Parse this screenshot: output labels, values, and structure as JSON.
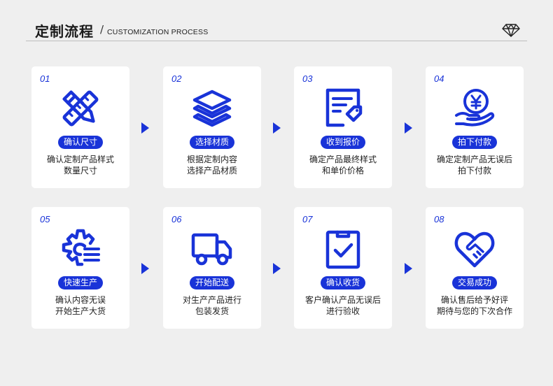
{
  "header": {
    "title": "定制流程",
    "separator": "/",
    "subtitle": "CUSTOMIZATION PROCESS"
  },
  "colors": {
    "accent": "#1933d8",
    "card": "#ffffff",
    "background": "#efefef"
  },
  "steps": [
    {
      "num": "01",
      "label": "确认尺寸",
      "line1": "确认定制产品样式",
      "line2": "数量尺寸",
      "icon": "pencil-ruler-icon"
    },
    {
      "num": "02",
      "label": "选择材质",
      "line1": "根据定制内容",
      "line2": "选择产品材质",
      "icon": "layers-icon"
    },
    {
      "num": "03",
      "label": "收到报价",
      "line1": "确定产品最终样式",
      "line2": "和单价价格",
      "icon": "price-sheet-icon"
    },
    {
      "num": "04",
      "label": "拍下付款",
      "line1": "确定定制产品无误后",
      "line2": "拍下付款",
      "icon": "yen-coin-hand-icon"
    },
    {
      "num": "05",
      "label": "快速生产",
      "line1": "确认内容无误",
      "line2": "开始生产大货",
      "icon": "gear-production-icon"
    },
    {
      "num": "06",
      "label": "开始配送",
      "line1": "对生产产品进行",
      "line2": "包装发货",
      "icon": "delivery-truck-icon"
    },
    {
      "num": "07",
      "label": "确认收货",
      "line1": "客户确认产品无误后",
      "line2": "进行验收",
      "icon": "clipboard-check-icon"
    },
    {
      "num": "08",
      "label": "交易成功",
      "line1": "确认售后给予好评",
      "line2": "期待与您的下次合作",
      "icon": "handshake-heart-icon"
    }
  ]
}
